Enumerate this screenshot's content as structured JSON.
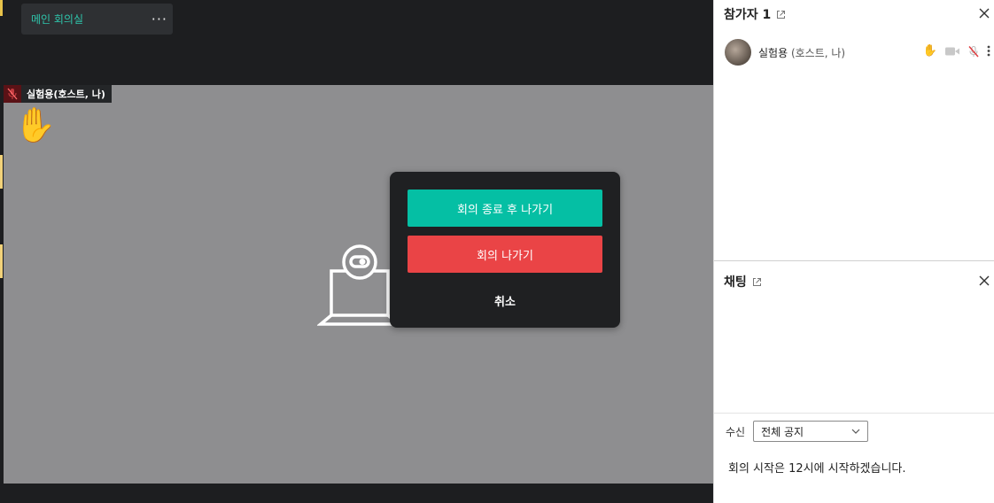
{
  "meeting": {
    "room_label": "메인 회의실",
    "more_label": "···",
    "self_tag": "실험용(호스트, 나)",
    "raise_hand_emoji": "✋"
  },
  "dialog": {
    "end_meeting_label": "회의 종료 후 나가기",
    "leave_meeting_label": "회의 나가기",
    "cancel_label": "취소"
  },
  "participants_panel": {
    "title": "참가자 1",
    "items": [
      {
        "name": "실험용",
        "host_suffix": "(호스트, 나)"
      }
    ]
  },
  "chat_panel": {
    "title": "채팅",
    "recipient_label": "수신",
    "recipient_value": "전체 공지",
    "notice_message": "회의 시작은 12시에 시작하겠습니다."
  },
  "colors": {
    "end_button": "#05bfa4",
    "leave_button": "#ea4446",
    "room_label": "#2fc6ac",
    "video_bg": "#8e8e90"
  }
}
